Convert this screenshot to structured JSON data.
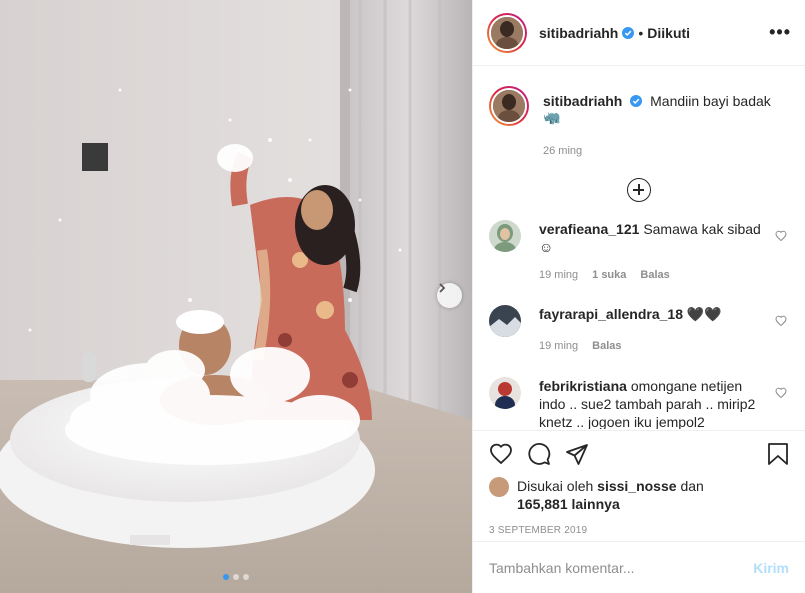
{
  "post": {
    "username": "sitibadriahh",
    "follow_separator": "•",
    "follow_label": "Diikuti",
    "more_label": "•••",
    "caption_text": "Mandiin bayi badak",
    "caption_emoji": "🦏",
    "caption_time": "26 ming",
    "load_more_icon": "plus-circle-icon",
    "carousel_next_icon": "chevron-right-icon",
    "carousel_dots": 3
  },
  "comments": [
    {
      "username": "verafieana_121",
      "text": "Samawa kak sibad☺",
      "time": "19 ming",
      "likes": "1 suka",
      "reply": "Balas",
      "avatar_color": "#8aa28a"
    },
    {
      "username": "fayrarapi_allendra_18",
      "text": "🖤🖤",
      "time": "19 ming",
      "likes": "",
      "reply": "Balas",
      "avatar_color": "#2f3640"
    },
    {
      "username": "febrikristiana",
      "text": "omongane netijen indo .. sue2 tambah parah .. mirip2 knetz .. jogoen iku jempol2",
      "time": "",
      "likes": "",
      "reply": "",
      "avatar_color": "#b93a32"
    }
  ],
  "actions": {
    "like_icon": "heart-icon",
    "comment_icon": "comment-icon",
    "share_icon": "share-icon",
    "save_icon": "bookmark-icon"
  },
  "likes": {
    "prefix": "Disukai oleh",
    "user": "sissi_nosse",
    "middle": "dan",
    "count": "165,881 lainnya"
  },
  "date": "3 SEPTEMBER 2019",
  "add_comment": {
    "placeholder": "Tambahkan komentar...",
    "post_label": "Kirim"
  },
  "colors": {
    "accent": "#3897f0",
    "post_disabled": "#b2dffc",
    "muted": "#8e8e8e",
    "text": "#262626"
  }
}
